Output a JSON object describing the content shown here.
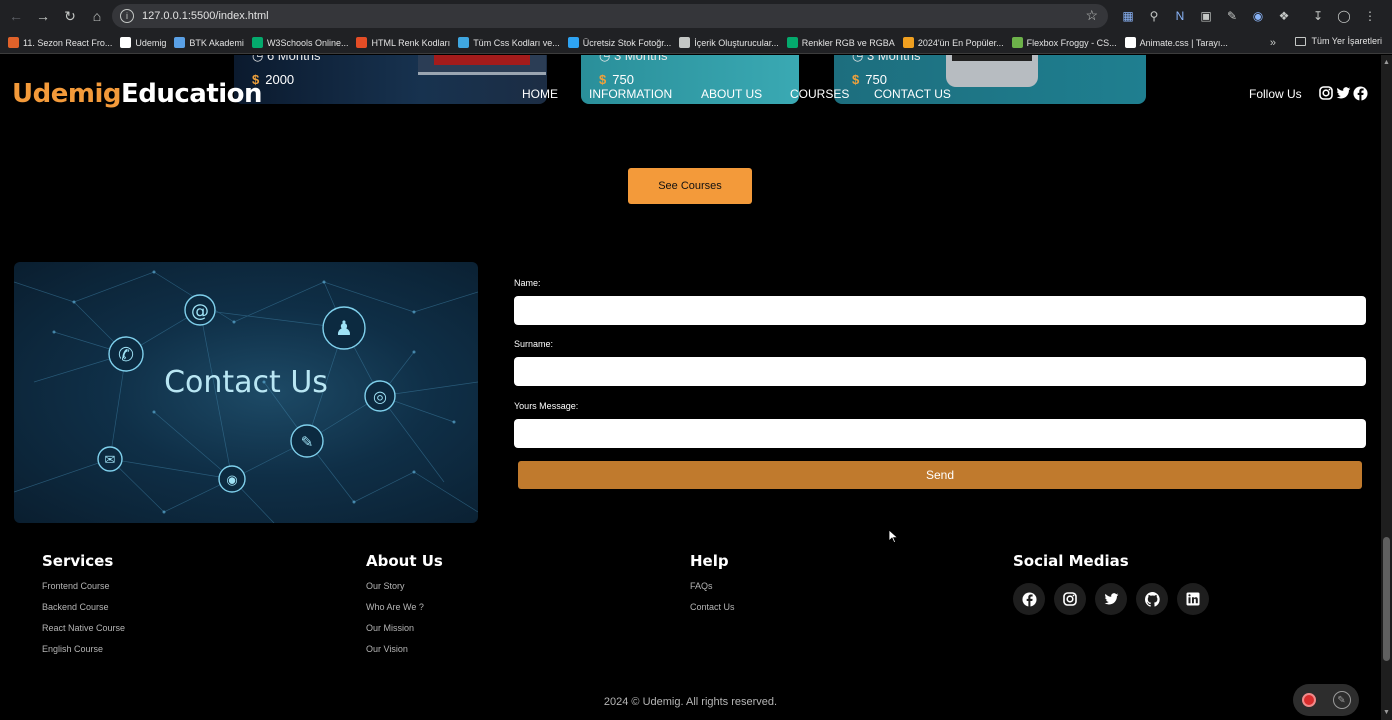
{
  "browser": {
    "url": "127.0.0.1:5500/index.html",
    "bookmarks": [
      {
        "label": "11. Sezon React Fro...",
        "color": "#e0622a"
      },
      {
        "label": "Udemig",
        "color": "#ffffff"
      },
      {
        "label": "BTK Akademi",
        "color": "#5aa0e6"
      },
      {
        "label": "W3Schools Online...",
        "color": "#04aa6d"
      },
      {
        "label": "HTML Renk Kodları",
        "color": "#e44d26"
      },
      {
        "label": "Tüm Css Kodları ve...",
        "color": "#3fa6e0"
      },
      {
        "label": "Ücretsiz Stok Fotoğr...",
        "color": "#2ea3f2"
      },
      {
        "label": "İçerik Oluşturucular...",
        "color": "#c4c7c5"
      },
      {
        "label": "Renkler RGB ve RGBA",
        "color": "#04aa6d"
      },
      {
        "label": "2024'ün En Popüler...",
        "color": "#f0a020"
      },
      {
        "label": "Flexbox Froggy - CS...",
        "color": "#6db24a"
      },
      {
        "label": "Animate.css | Tarayı...",
        "color": "#ffffff"
      }
    ],
    "bookmarks_more": "»",
    "all_bookmarks": "Tüm Yer İşaretleri"
  },
  "cards": [
    {
      "duration": "6 Months",
      "price": "2000"
    },
    {
      "duration": "3 Months",
      "price": "750"
    },
    {
      "duration": "3 Months",
      "price": "750"
    }
  ],
  "currency": "$",
  "header": {
    "brand_part1": "Udemig",
    "brand_part2": "Education",
    "menu": [
      "HOME",
      "INFORMATION",
      "ABOUT US",
      "COURSES",
      "CONTACT US"
    ],
    "follow": "Follow Us"
  },
  "see_courses": "See Courses",
  "contact": {
    "image_title": "Contact Us",
    "name_label": "Name:",
    "surname_label": "Surname:",
    "message_label": "Yours Message:",
    "send": "Send"
  },
  "footer": {
    "services": {
      "title": "Services",
      "links": [
        "Frontend Course",
        "Backend Course",
        "React Native Course",
        "English Course"
      ]
    },
    "about": {
      "title": "About Us",
      "links": [
        "Our Story",
        "Who Are We ?",
        "Our Mission",
        "Our Vision"
      ]
    },
    "help": {
      "title": "Help",
      "links": [
        "FAQs",
        "Contact Us"
      ]
    },
    "social": {
      "title": "Social Medias",
      "icons": [
        "facebook-icon",
        "instagram-icon",
        "twitter-icon",
        "github-icon",
        "linkedin-icon"
      ]
    },
    "copyright": "2024 © Udemig. All rights reserved."
  },
  "colors": {
    "accent": "#f39a3a",
    "send": "#c07a2d",
    "background": "#000000"
  }
}
